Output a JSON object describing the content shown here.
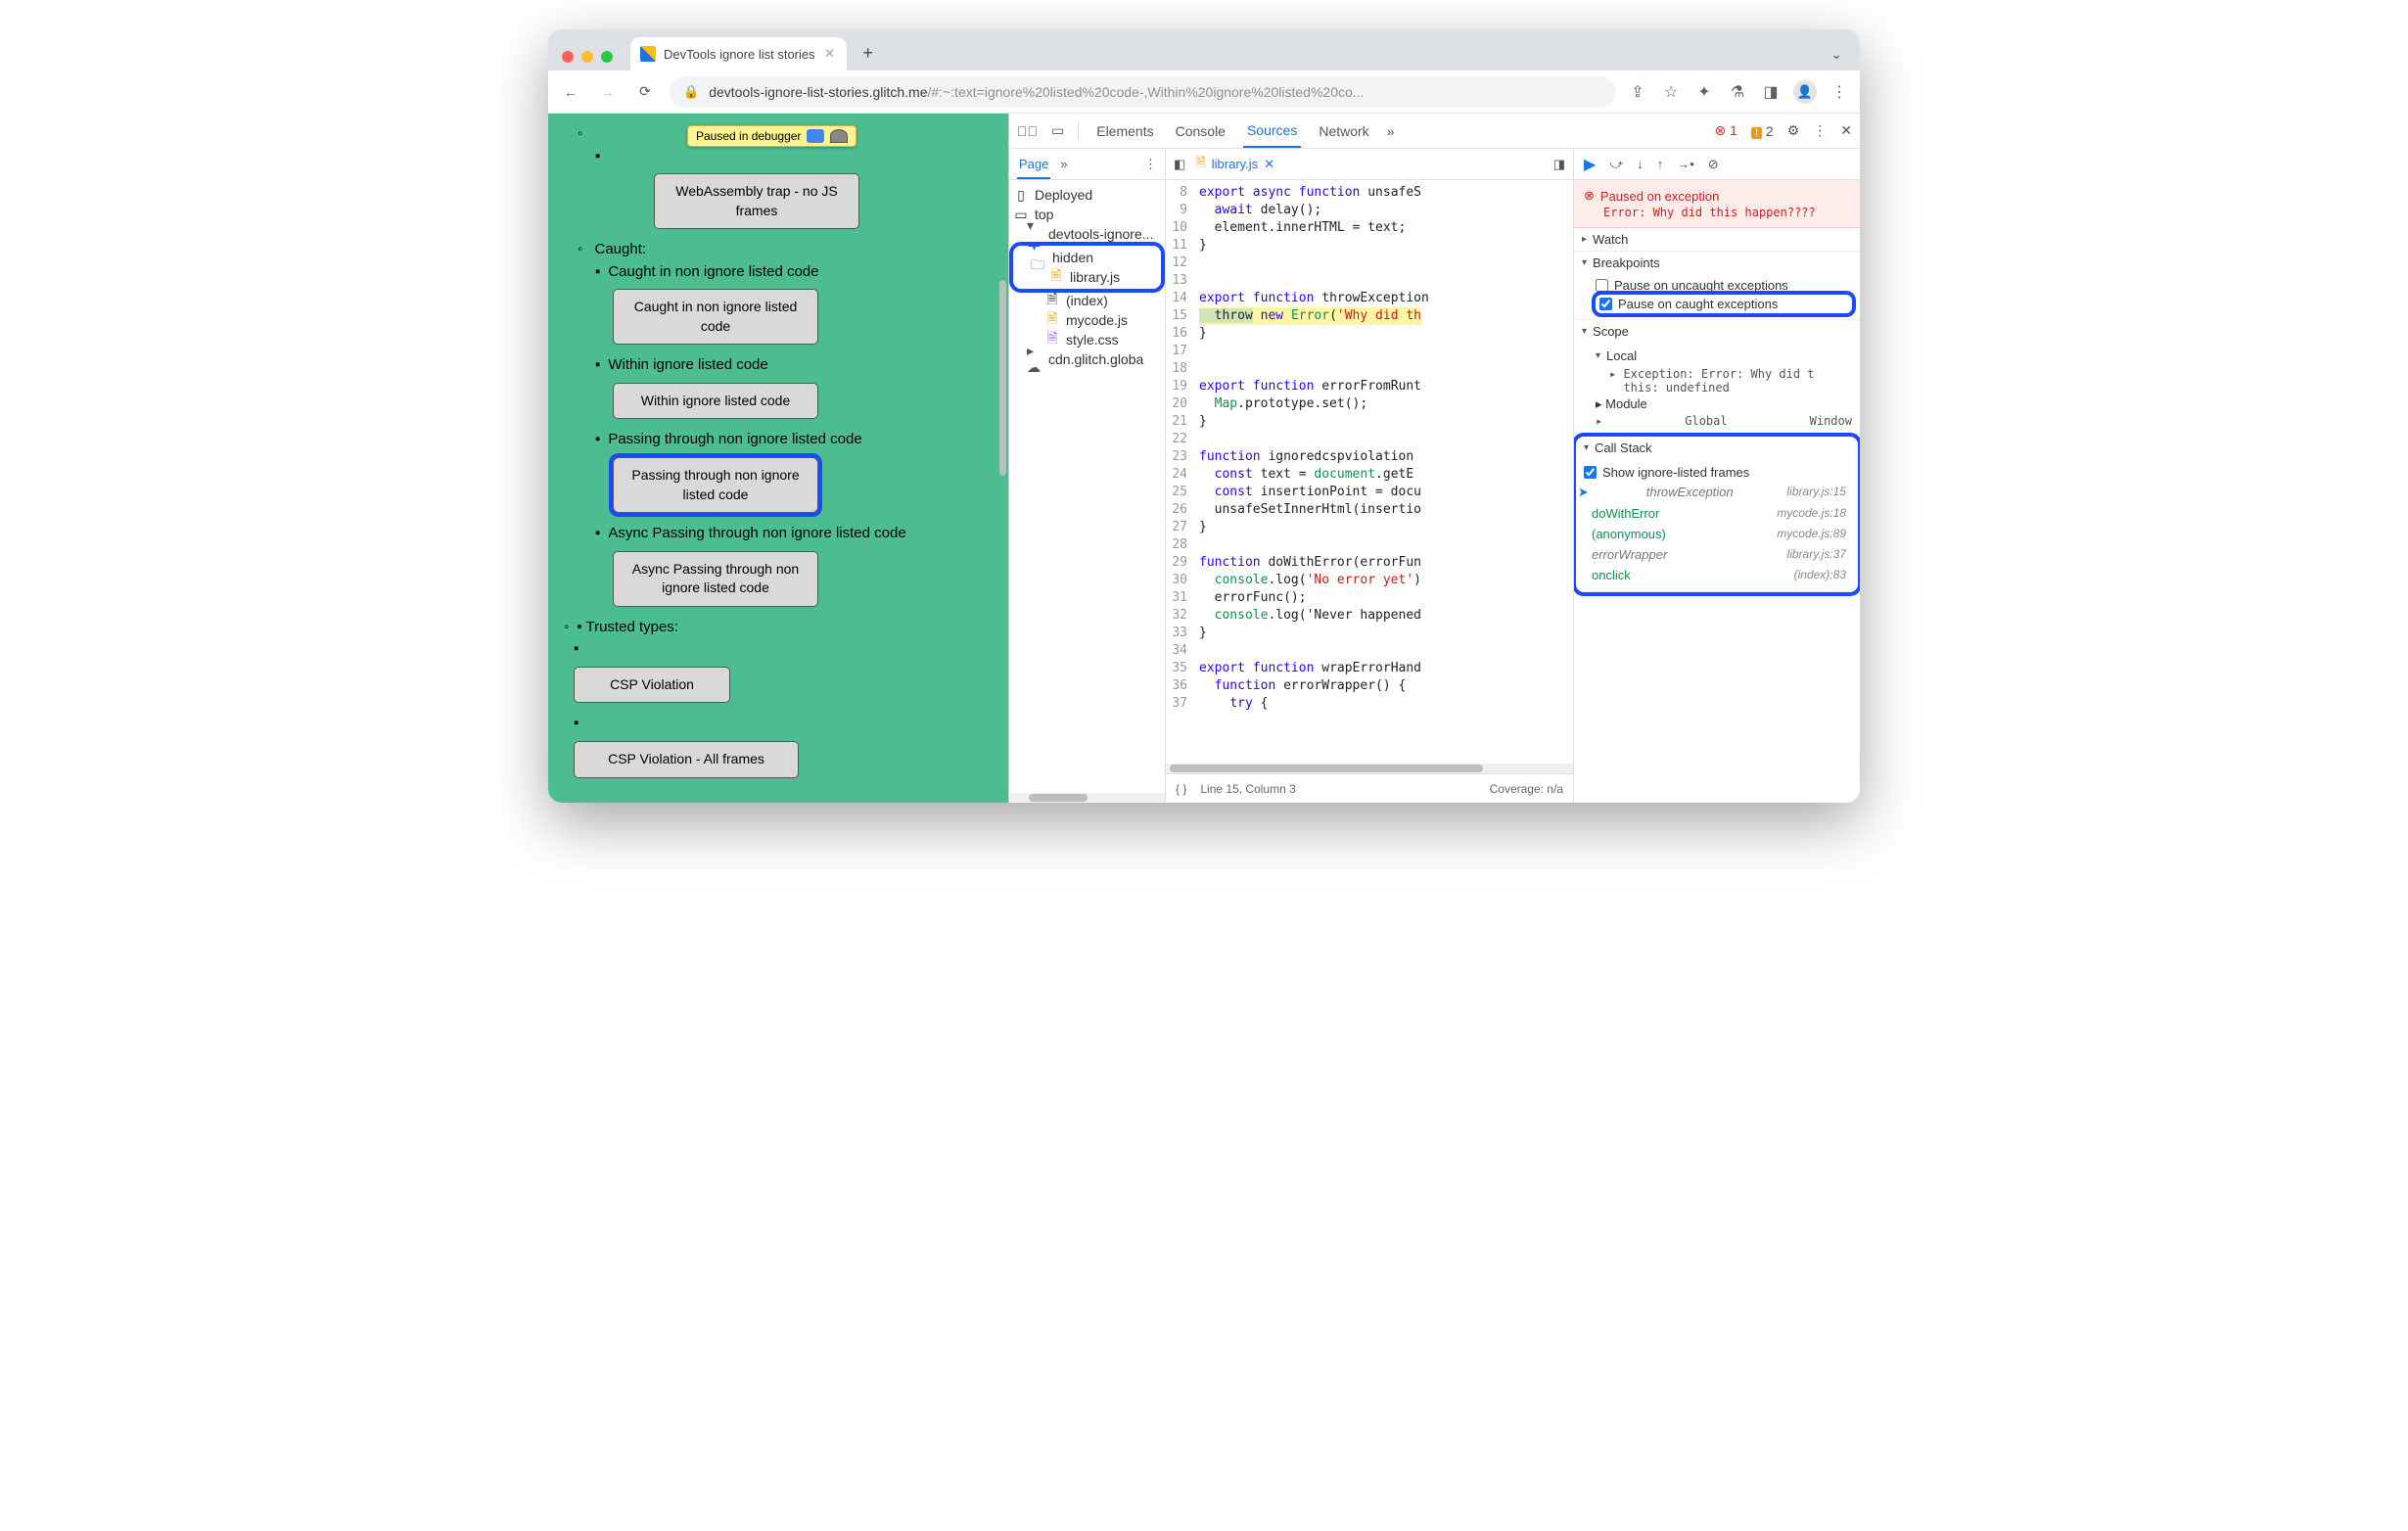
{
  "tabbar": {
    "title": "DevTools ignore list stories"
  },
  "urlbar": {
    "domain": "devtools-ignore-list-stories.glitch.me",
    "rest": "/#:~:text=ignore%20listed%20code-,Within%20ignore%20listed%20co..."
  },
  "paused_label": "Paused in debugger",
  "page": {
    "item0": {
      "label": "WebAssembly trap - no JS frames"
    },
    "caught_label": "Caught:",
    "caught_item1": {
      "text": "Caught in non ignore listed code",
      "btn": "Caught in non ignore listed code"
    },
    "caught_item2": {
      "text": "Within ignore listed code",
      "btn": "Within ignore listed code"
    },
    "caught_item3": {
      "text": "Passing through non ignore listed code",
      "btn": "Passing through non ignore listed code"
    },
    "caught_item4": {
      "text": "Async Passing through non ignore listed code",
      "btn": "Async Passing through non ignore listed code"
    },
    "trusted_label": "Trusted types:",
    "trusted_btn1": "CSP Violation",
    "trusted_btn2": "CSP Violation - All frames"
  },
  "dtTop": {
    "elements": "Elements",
    "console": "Console",
    "sources": "Sources",
    "network": "Network",
    "errCount": "1",
    "warnCount": "2"
  },
  "nav": {
    "pageTab": "Page",
    "deployed": "Deployed",
    "top": "top",
    "domain": "devtools-ignore...",
    "hidden": "hidden",
    "library": "library.js",
    "index": "(index)",
    "mycode": "mycode.js",
    "style": "style.css",
    "cdn": "cdn.glitch.globa"
  },
  "editor": {
    "filename": "library.js",
    "lines": {
      "8": "export async function unsafeS",
      "9": "  await delay();",
      "10": "  element.innerHTML = text;",
      "11": "}",
      "12": "",
      "13": "",
      "14": "export function throwException",
      "15": "  throw new Error('Why did th",
      "16": "}",
      "17": "",
      "18": "",
      "19": "export function errorFromRunt",
      "20": "  Map.prototype.set();",
      "21": "}",
      "22": "",
      "23": "function ignoredcspviolation",
      "24": "  const text = document.getE",
      "25": "  const insertionPoint = docu",
      "26": "  unsafeSetInnerHtml(insertio",
      "27": "}",
      "28": "",
      "29": "function doWithError(errorFun",
      "30": "  console.log('No error yet')",
      "31": "  errorFunc();",
      "32": "  console.log('Never happened",
      "33": "}",
      "34": "",
      "35": "export function wrapErrorHand",
      "36": "  function errorWrapper() {",
      "37": "    try {"
    },
    "statusLine": "Line 15, Column 3",
    "coverage": "Coverage: n/a"
  },
  "debug": {
    "ex_title": "Paused on exception",
    "ex_msg": "Error: Why did this happen????",
    "watch": "Watch",
    "breakpoints": "Breakpoints",
    "bp_uncaught": "Pause on uncaught exceptions",
    "bp_caught": "Pause on caught exceptions",
    "scope": "Scope",
    "scope_local": "Local",
    "scope_exc": "Exception: Error: Why did t",
    "scope_this": "this: undefined",
    "scope_module": "Module",
    "scope_global": "Global",
    "scope_global_v": "Window",
    "callstack": "Call Stack",
    "cs_showign": "Show ignore-listed frames",
    "frames": [
      {
        "fn": "throwException",
        "loc": "library.js:15",
        "ign": true,
        "cur": true
      },
      {
        "fn": "doWithError",
        "loc": "mycode.js:18",
        "ign": false
      },
      {
        "fn": "(anonymous)",
        "loc": "mycode.js:89",
        "ign": false
      },
      {
        "fn": "errorWrapper",
        "loc": "library.js:37",
        "ign": true
      },
      {
        "fn": "onclick",
        "loc": "(index):83",
        "ign": false
      }
    ]
  }
}
